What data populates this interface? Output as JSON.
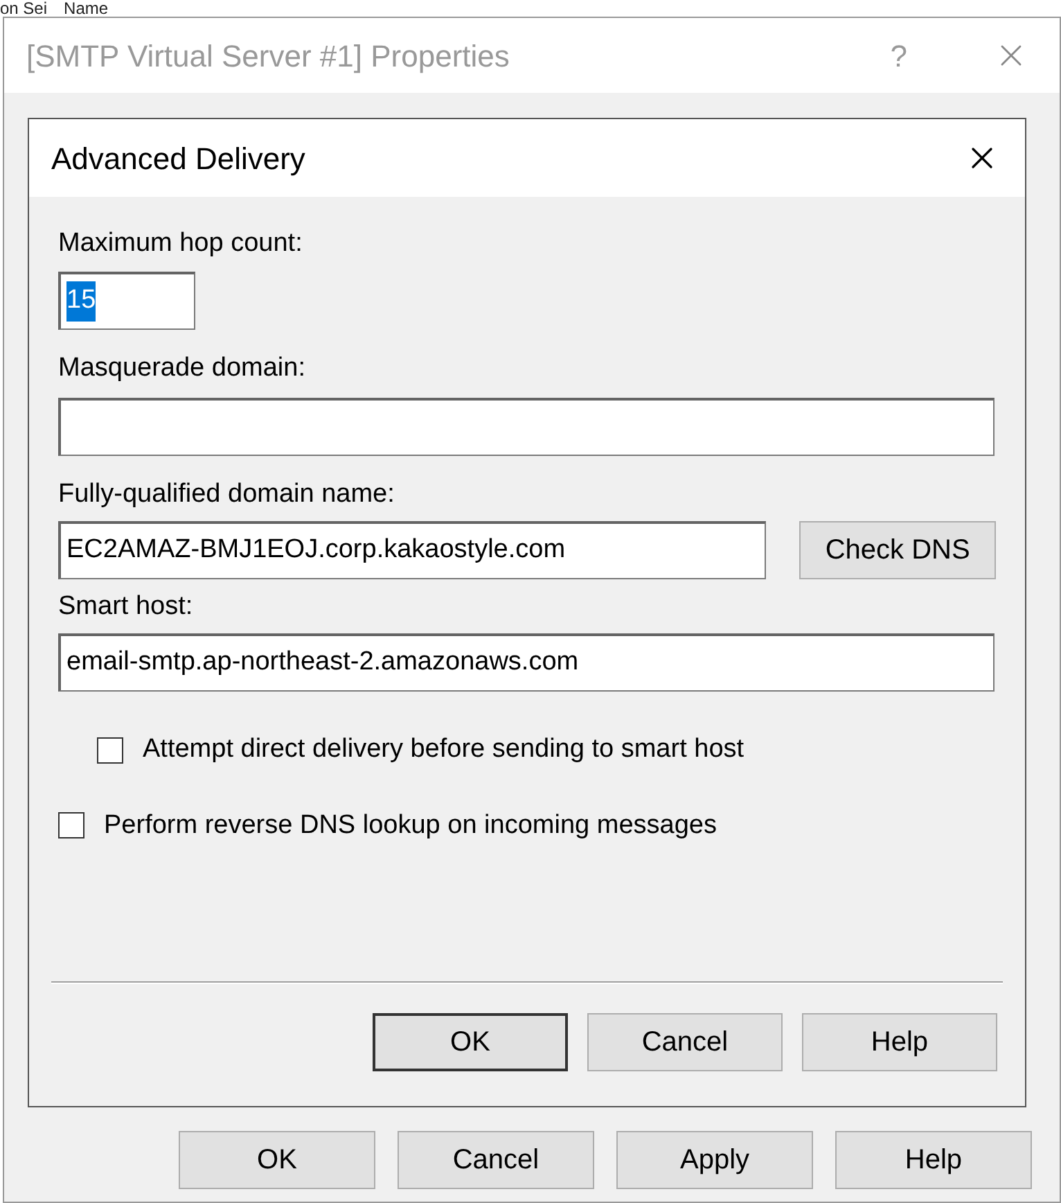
{
  "background": {
    "column_labels": [
      "on Sei",
      "Name"
    ]
  },
  "properties_window": {
    "title": "[SMTP Virtual Server #1] Properties",
    "help_glyph": "?",
    "buttons": [
      {
        "label": "OK",
        "default": false
      },
      {
        "label": "Cancel",
        "default": false
      },
      {
        "label": "Apply",
        "default": false
      },
      {
        "label": "Help",
        "default": false
      }
    ]
  },
  "dialog": {
    "title": "Advanced Delivery",
    "hop_count": {
      "label": "Maximum hop count:",
      "value": "15",
      "text_selected": true
    },
    "masquerade_domain": {
      "label": "Masquerade domain:"
    },
    "fqdn": {
      "label": "Fully-qualified domain name:",
      "value": "EC2AMAZ-BMJ1EOJ.corp.kakaostyle.com",
      "button": "Check DNS"
    },
    "smart_host": {
      "label": "Smart host:",
      "value": "email-smtp.ap-northeast-2.amazonaws.com",
      "options": [
        {
          "label": "Attempt direct delivery before sending to smart host",
          "checked": false
        }
      ]
    },
    "options": [
      {
        "label": "Perform reverse DNS lookup on incoming messages",
        "checked": false
      }
    ],
    "buttons": [
      {
        "label": "OK",
        "default": true
      },
      {
        "label": "Cancel",
        "default": false
      },
      {
        "label": "Help",
        "default": false
      }
    ]
  }
}
